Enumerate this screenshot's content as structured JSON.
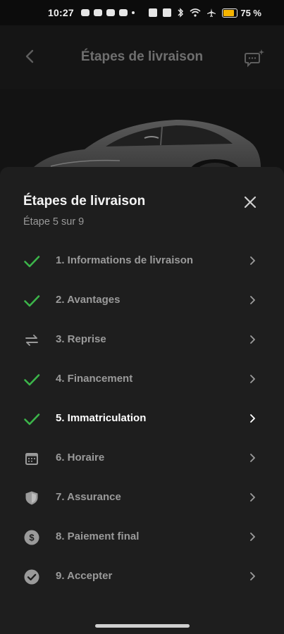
{
  "status_bar": {
    "time": "10:27",
    "battery_percent": "75 %",
    "battery_level": 0.75,
    "battery_color": "#f5b400"
  },
  "header": {
    "title": "Étapes de livraison",
    "back_icon": "chevron-left-icon",
    "chat_icon": "chat-sparkle-icon"
  },
  "sheet": {
    "title": "Étapes de livraison",
    "subtitle": "Étape 5 sur 9",
    "close_icon": "close-icon",
    "accent_color": "#3cb54a",
    "steps": [
      {
        "label": "1. Informations de livraison",
        "icon": "check-icon",
        "status": "done"
      },
      {
        "label": "2. Avantages",
        "icon": "check-icon",
        "status": "done"
      },
      {
        "label": "3. Reprise",
        "icon": "swap-arrows-icon",
        "status": "pending"
      },
      {
        "label": "4. Financement",
        "icon": "check-icon",
        "status": "done"
      },
      {
        "label": "5. Immatriculation",
        "icon": "check-icon",
        "status": "current"
      },
      {
        "label": "6. Horaire",
        "icon": "calendar-icon",
        "status": "pending"
      },
      {
        "label": "7. Assurance",
        "icon": "shield-icon",
        "status": "pending"
      },
      {
        "label": "8. Paiement final",
        "icon": "dollar-circle-icon",
        "status": "pending"
      },
      {
        "label": "9. Accepter",
        "icon": "check-circle-icon",
        "status": "pending"
      }
    ]
  }
}
